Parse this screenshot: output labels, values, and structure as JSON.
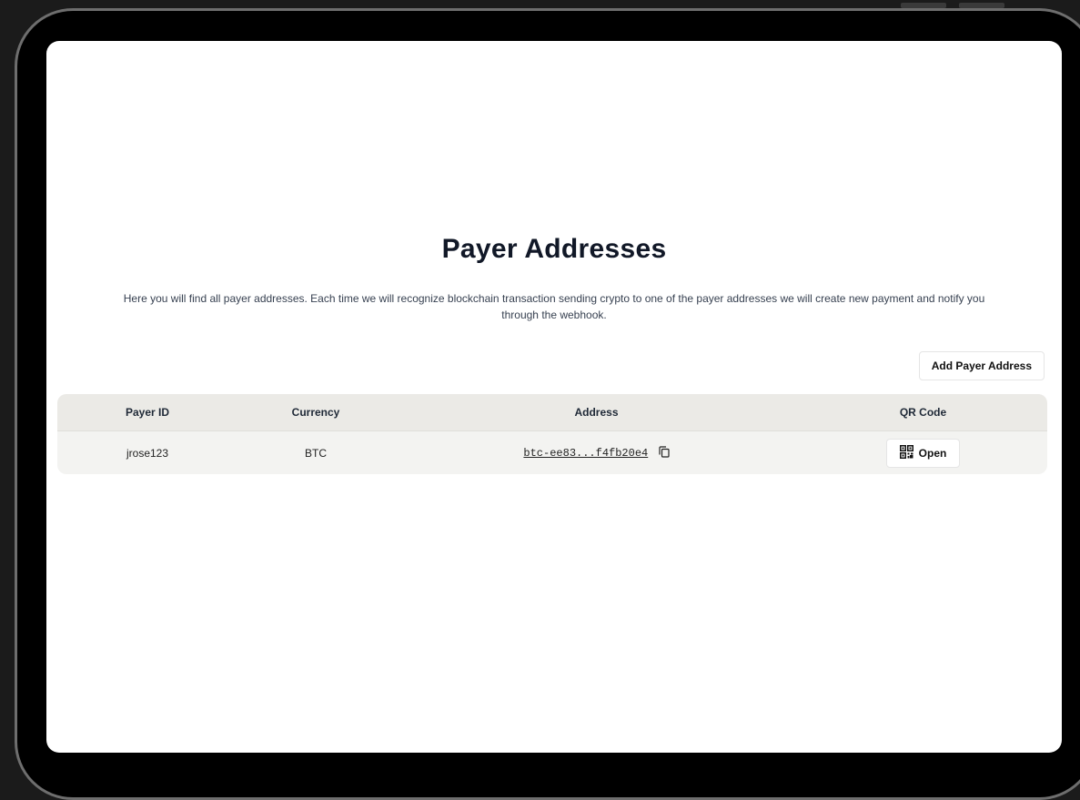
{
  "page": {
    "title": "Payer Addresses",
    "description": "Here you will find all payer addresses. Each time we will recognize blockchain transaction sending crypto to one of the payer addresses we will create new payment and notify you through the webhook."
  },
  "actions": {
    "add_label": "Add Payer Address"
  },
  "table": {
    "columns": [
      "Payer ID",
      "Currency",
      "Address",
      "QR Code"
    ],
    "rows": [
      {
        "payer_id": "jrose123",
        "currency": "BTC",
        "address": "btc-ee83...f4fb20e4",
        "qr_label": "Open"
      }
    ]
  },
  "icons": {
    "copy": "copy-icon",
    "qr": "qr-code-icon"
  },
  "colors": {
    "header_bg": "#ebeae6",
    "row_bg": "#f3f3f1",
    "title": "#111827"
  }
}
